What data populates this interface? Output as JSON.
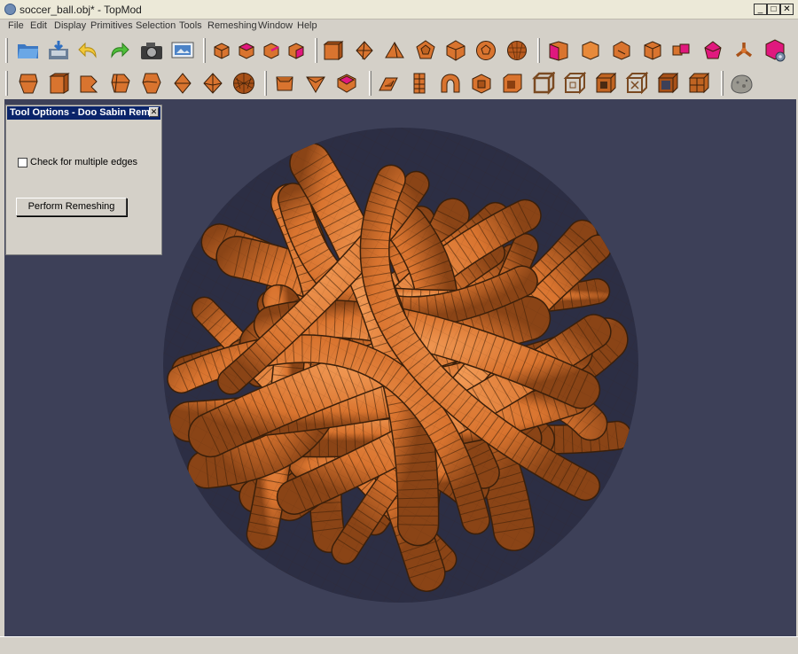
{
  "window": {
    "title": "soccer_ball.obj* - TopMod",
    "min_glyph": "_",
    "max_glyph": "□",
    "close_glyph": "✕"
  },
  "menubar": {
    "items": [
      "File",
      "Edit",
      "Display",
      "Primitives",
      "Selection",
      "Tools",
      "Remeshing",
      "Window",
      "Help"
    ]
  },
  "toolbars": {
    "row1": {
      "file_tools": [
        "open-icon",
        "save-icon",
        "undo-icon",
        "redo-icon",
        "screenshot-icon",
        "render-icon"
      ],
      "selection_modes": [
        "select-vertex-icon",
        "select-face-icon",
        "select-edge-icon",
        "select-corner-icon"
      ],
      "primitives": [
        "cube-primitive-icon",
        "octahedron-primitive-icon",
        "tetrahedron-primitive-icon",
        "dodecahedron-primitive-icon",
        "icosahedron-primitive-icon",
        "soccer-ball-primitive-icon",
        "geodesic-primitive-icon"
      ],
      "operations": [
        "insert-edge-icon",
        "delete-edge-icon",
        "collapse-edge-icon",
        "subdivide-edge-icon",
        "connect-edges-icon",
        "splice-corners-icon",
        "transforms-icon",
        "tool-options-icon"
      ]
    },
    "row2": {
      "remeshing_a": [
        "doo-sabin-icon",
        "catmull-clark-icon",
        "honeycomb-icon",
        "root4-icon",
        "corner-cutting-icon",
        "pentagonal-icon",
        "triangular-icon",
        "loop-icon"
      ],
      "remeshing_b": [
        "stellation-icon",
        "double-stellation-icon",
        "dome-icon"
      ],
      "high_genus": [
        "wireframe-icon",
        "column-modeling-icon",
        "sierpinsky-icon",
        "multi-face-handle-icon",
        "menger-sponge-icon",
        "crust-icon",
        "lattice-icon",
        "frame-icon",
        "cage-icon",
        "hollow-frame-icon",
        "extrude-icon",
        "texture-icon"
      ],
      "extras": [
        "rock-texture-icon"
      ]
    }
  },
  "tool_panel": {
    "title": "Tool Options - Doo Sabin Rem...",
    "close_glyph": "✕",
    "checkbox_label": "Check for multiple edges",
    "checkbox_checked": false,
    "button_label": "Perform Remeshing"
  },
  "viewport": {
    "background": "#3d4058",
    "model": "soccer-ball-mesh",
    "mesh_color": "#d9742f"
  }
}
